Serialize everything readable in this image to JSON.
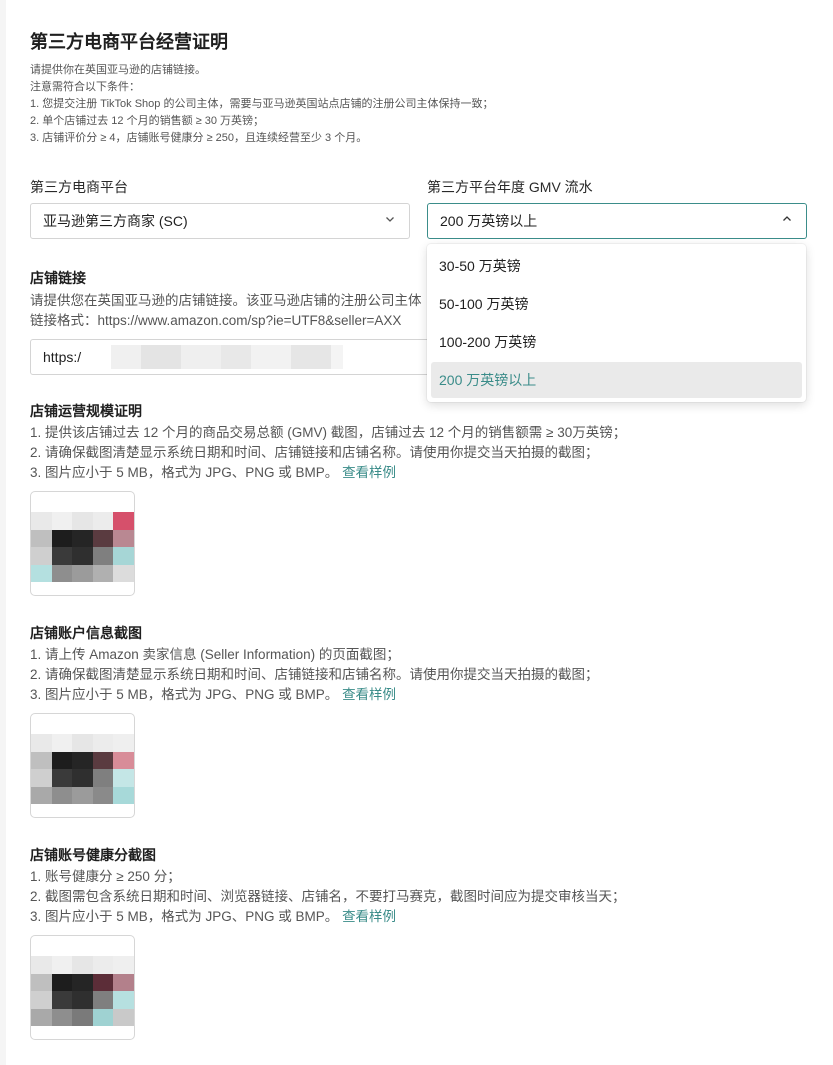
{
  "page": {
    "title": "第三方电商平台经营证明",
    "intro": [
      "请提供你在英国亚马逊的店铺链接。",
      "注意需符合以下条件：",
      "1. 您提交注册 TikTok Shop 的公司主体，需要与亚马逊英国站点店铺的注册公司主体保持一致；",
      "2. 单个店铺过去 12 个月的销售额 ≥ 30 万英镑；",
      "3. 店铺评价分 ≥ 4，店铺账号健康分 ≥ 250，且连续经营至少 3 个月。"
    ]
  },
  "platform": {
    "label": "第三方电商平台",
    "value": "亚马逊第三方商家 (SC)"
  },
  "gmv": {
    "label": "第三方平台年度 GMV 流水",
    "value": "200 万英镑以上",
    "options": [
      "30-50 万英镑",
      "50-100 万英镑",
      "100-200 万英镑",
      "200 万英镑以上"
    ],
    "selected_index": 3
  },
  "store_link": {
    "title": "店铺链接",
    "desc": [
      "请提供您在英国亚马逊的店铺链接。该亚马逊店铺的注册公司主体",
      "链接格式：https://www.amazon.com/sp?ie=UTF8&seller=AXX"
    ],
    "value": "https:/"
  },
  "scale_proof": {
    "title": "店铺运营规模证明",
    "desc": [
      "1. 提供该店铺过去 12 个月的商品交易总额 (GMV) 截图，店铺过去 12 个月的销售额需 ≥ 30万英镑；",
      "2. 请确保截图清楚显示系统日期和时间、店铺链接和店铺名称。请使用你提交当天拍摄的截图；",
      "3. 图片应小于 5 MB，格式为 JPG、PNG 或 BMP。"
    ],
    "example_link": "查看样例"
  },
  "seller_info": {
    "title": "店铺账户信息截图",
    "desc": [
      "1. 请上传 Amazon 卖家信息 (Seller Information) 的页面截图；",
      "2. 请确保截图清楚显示系统日期和时间、店铺链接和店铺名称。请使用你提交当天拍摄的截图；",
      "3. 图片应小于 5 MB，格式为 JPG、PNG 或 BMP。"
    ],
    "example_link": "查看样例"
  },
  "health_score": {
    "title": "店铺账号健康分截图",
    "desc": [
      "1. 账号健康分 ≥ 250 分；",
      "2. 截图需包含系统日期和时间、浏览器链接、店铺名，不要打马赛克，截图时间应为提交审核当天；",
      "3. 图片应小于 5 MB，格式为 JPG、PNG 或 BMP。"
    ],
    "example_link": "查看样例"
  },
  "colors": {
    "accent": "#3a8c89",
    "selected_bg": "#eaeaea",
    "border": "#d4d4d4"
  },
  "icons": {
    "platform_select": "chevron-down-icon",
    "gmv_select": "chevron-up-icon"
  }
}
